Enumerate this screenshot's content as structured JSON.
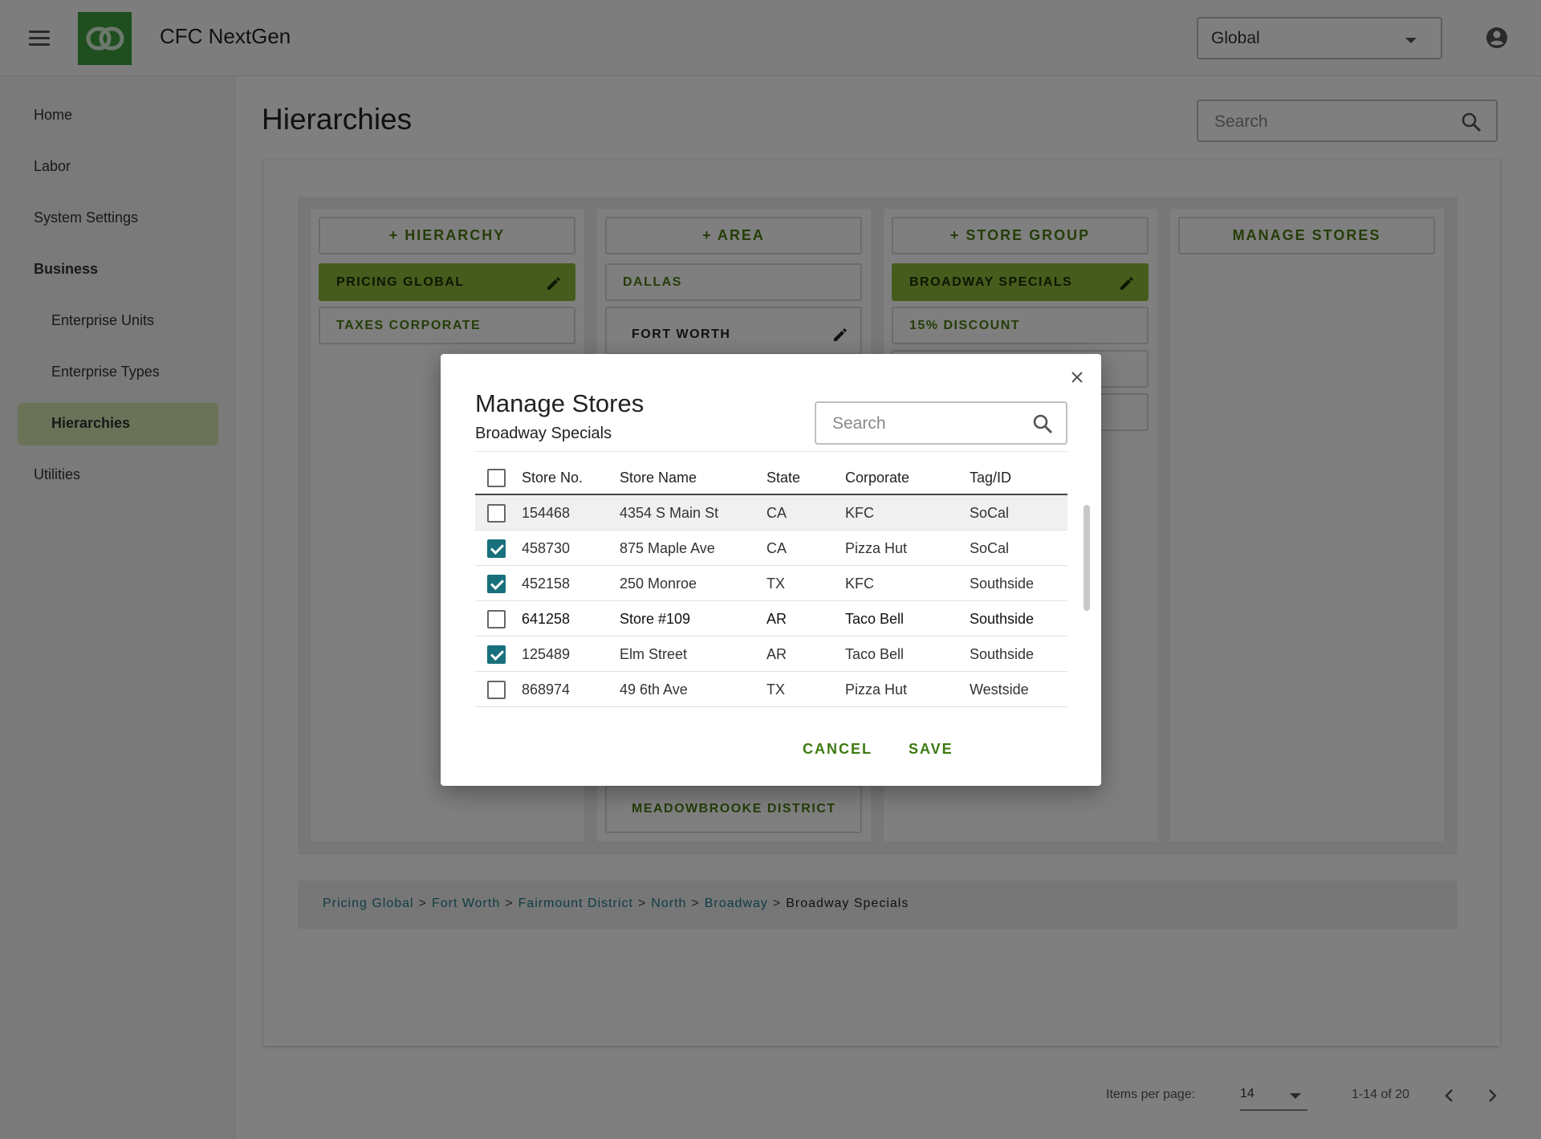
{
  "header": {
    "app_title": "CFC NextGen",
    "scope_value": "Global"
  },
  "sidebar": {
    "items": [
      {
        "label": "Home"
      },
      {
        "label": "Labor"
      },
      {
        "label": "System Settings"
      },
      {
        "label": "Business"
      },
      {
        "label": "Enterprise Units"
      },
      {
        "label": "Enterprise Types"
      },
      {
        "label": "Hierarchies"
      },
      {
        "label": "Utilities"
      }
    ],
    "active": "Hierarchies"
  },
  "page": {
    "title": "Hierarchies",
    "search_placeholder": "Search"
  },
  "columns": {
    "hierarchy": {
      "add_label": "+ HIERARCHY",
      "items": [
        "PRICING GLOBAL",
        "TAXES CORPORATE"
      ]
    },
    "area": {
      "add_label": "+ AREA",
      "items": [
        "DALLAS",
        "FORT WORTH",
        "MEADOWBROOKE DISTRICT"
      ]
    },
    "store_group": {
      "add_label": "+ STORE GROUP",
      "items": [
        "BROADWAY SPECIALS",
        "15% DISCOUNT"
      ]
    },
    "manage_stores": {
      "label": "MANAGE STORES"
    }
  },
  "breadcrumb": {
    "links": [
      "Pricing Global",
      "Fort Worth",
      "Fairmount District",
      "North",
      "Broadway"
    ],
    "current": "Broadway Specials",
    "separator": ">"
  },
  "pagination": {
    "items_per_page_label": "Items per page:",
    "items_per_page": "14",
    "range": "1-14 of 20"
  },
  "dialog": {
    "title": "Manage Stores",
    "subtitle": "Broadway Specials",
    "search_placeholder": "Search",
    "columns": [
      "Store No.",
      "Store Name",
      "State",
      "Corporate",
      "Tag/ID"
    ],
    "rows": [
      {
        "no": "154468",
        "name": "4354 S Main St",
        "state": "CA",
        "corporate": "KFC",
        "tag": "SoCal",
        "checked": false
      },
      {
        "no": "458730",
        "name": "875 Maple Ave",
        "state": "CA",
        "corporate": "Pizza Hut",
        "tag": "SoCal",
        "checked": true
      },
      {
        "no": "452158",
        "name": "250 Monroe",
        "state": "TX",
        "corporate": "KFC",
        "tag": "Southside",
        "checked": true
      },
      {
        "no": "641258",
        "name": "Store #109",
        "state": "AR",
        "corporate": "Taco Bell",
        "tag": "Southside",
        "checked": false
      },
      {
        "no": "125489",
        "name": "Elm Street",
        "state": "AR",
        "corporate": "Taco Bell",
        "tag": "Southside",
        "checked": true
      },
      {
        "no": "868974",
        "name": "49 6th Ave",
        "state": "TX",
        "corporate": "Pizza Hut",
        "tag": "Westside",
        "checked": false
      }
    ],
    "cancel_label": "CANCEL",
    "save_label": "SAVE"
  },
  "colors": {
    "brand_green": "#3e9e3e",
    "accent_green": "#8cb83a",
    "checkbox_teal": "#17707c",
    "link_teal": "#1e7a86"
  },
  "icons": [
    "menu-icon",
    "logo-icon",
    "account-circle-icon",
    "search-icon",
    "pencil-icon",
    "close-icon",
    "chevron-left-icon",
    "chevron-right-icon",
    "dropdown-caret-icon"
  ]
}
